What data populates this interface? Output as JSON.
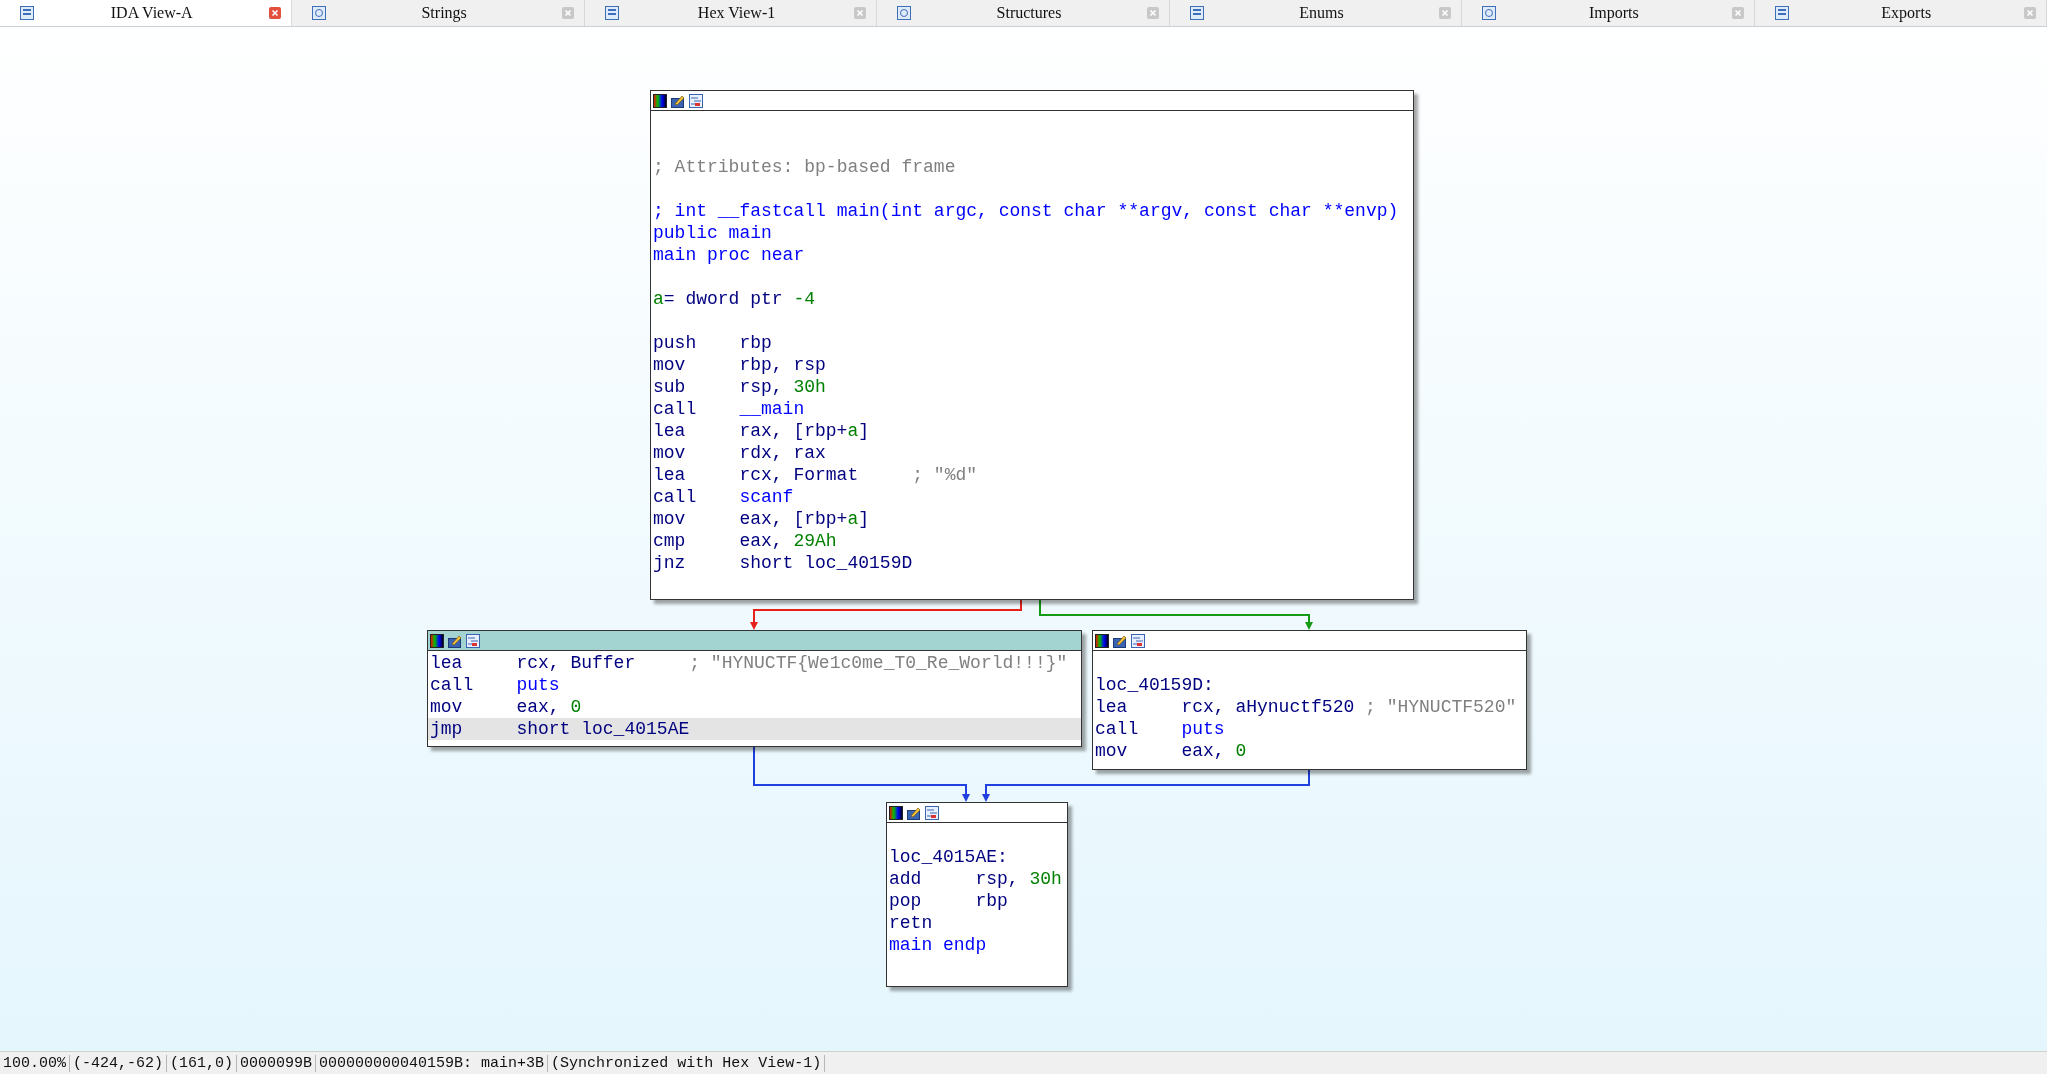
{
  "tabs": [
    {
      "label": "IDA View-A",
      "selected": true
    },
    {
      "label": "Strings",
      "selected": false
    },
    {
      "label": "Hex View-1",
      "selected": false
    },
    {
      "label": "Structures",
      "selected": false
    },
    {
      "label": "Enums",
      "selected": false
    },
    {
      "label": "Imports",
      "selected": false
    },
    {
      "label": "Exports",
      "selected": false
    }
  ],
  "graph": {
    "blocks": [
      {
        "active": false,
        "lines": [
          {
            "kind": "blank"
          },
          {
            "kind": "blank"
          },
          {
            "kind": "code",
            "selected": false,
            "parts": [
              {
                "kind": "comment",
                "text": "; Attributes: bp-based frame"
              }
            ]
          },
          {
            "kind": "blank"
          },
          {
            "kind": "code",
            "selected": false,
            "parts": [
              {
                "kind": "name",
                "text": "; int __fastcall main(int argc, const char **argv, const char **envp)"
              }
            ]
          },
          {
            "kind": "code",
            "selected": false,
            "parts": [
              {
                "kind": "name",
                "text": "public main"
              }
            ]
          },
          {
            "kind": "code",
            "selected": false,
            "parts": [
              {
                "kind": "name",
                "text": "main proc near"
              }
            ]
          },
          {
            "kind": "blank"
          },
          {
            "kind": "code",
            "selected": false,
            "parts": [
              {
                "kind": "number",
                "text": "a"
              },
              {
                "kind": "plain",
                "text": "= dword ptr "
              },
              {
                "kind": "number",
                "text": "-4"
              }
            ]
          },
          {
            "kind": "blank"
          },
          {
            "kind": "code",
            "selected": false,
            "parts": [
              {
                "kind": "mnemonic",
                "text": "push"
              },
              {
                "kind": "plain",
                "text": "rbp"
              }
            ]
          },
          {
            "kind": "code",
            "selected": false,
            "parts": [
              {
                "kind": "mnemonic",
                "text": "mov"
              },
              {
                "kind": "plain",
                "text": "rbp, rsp"
              }
            ]
          },
          {
            "kind": "code",
            "selected": false,
            "parts": [
              {
                "kind": "mnemonic",
                "text": "sub"
              },
              {
                "kind": "plain",
                "text": "rsp, "
              },
              {
                "kind": "number",
                "text": "30h"
              }
            ]
          },
          {
            "kind": "code",
            "selected": false,
            "parts": [
              {
                "kind": "mnemonic",
                "text": "call"
              },
              {
                "kind": "name",
                "text": "__main"
              }
            ]
          },
          {
            "kind": "code",
            "selected": false,
            "parts": [
              {
                "kind": "mnemonic",
                "text": "lea"
              },
              {
                "kind": "plain",
                "text": "rax, [rbp+"
              },
              {
                "kind": "number",
                "text": "a"
              },
              {
                "kind": "plain",
                "text": "]"
              }
            ]
          },
          {
            "kind": "code",
            "selected": false,
            "parts": [
              {
                "kind": "mnemonic",
                "text": "mov"
              },
              {
                "kind": "plain",
                "text": "rdx, rax"
              }
            ]
          },
          {
            "kind": "code",
            "selected": false,
            "parts": [
              {
                "kind": "mnemonic",
                "text": "lea"
              },
              {
                "kind": "plain",
                "text": "rcx, Format     "
              },
              {
                "kind": "comment",
                "text": "; \"%d\""
              }
            ]
          },
          {
            "kind": "code",
            "selected": false,
            "parts": [
              {
                "kind": "mnemonic",
                "text": "call"
              },
              {
                "kind": "name",
                "text": "scanf"
              }
            ]
          },
          {
            "kind": "code",
            "selected": false,
            "parts": [
              {
                "kind": "mnemonic",
                "text": "mov"
              },
              {
                "kind": "plain",
                "text": "eax, [rbp+"
              },
              {
                "kind": "number",
                "text": "a"
              },
              {
                "kind": "plain",
                "text": "]"
              }
            ]
          },
          {
            "kind": "code",
            "selected": false,
            "parts": [
              {
                "kind": "mnemonic",
                "text": "cmp"
              },
              {
                "kind": "plain",
                "text": "eax, "
              },
              {
                "kind": "number",
                "text": "29Ah"
              }
            ]
          },
          {
            "kind": "code",
            "selected": false,
            "parts": [
              {
                "kind": "mnemonic",
                "text": "jnz"
              },
              {
                "kind": "plain",
                "text": "short loc_40159D"
              }
            ]
          }
        ]
      },
      {
        "active": true,
        "lines": [
          {
            "kind": "code",
            "selected": false,
            "parts": [
              {
                "kind": "mnemonic",
                "text": "lea"
              },
              {
                "kind": "plain",
                "text": "rcx, Buffer     "
              },
              {
                "kind": "comment",
                "text": "; \"HYNUCTF{We1c0me_T0_Re_World!!!}\""
              }
            ]
          },
          {
            "kind": "code",
            "selected": false,
            "parts": [
              {
                "kind": "mnemonic",
                "text": "call"
              },
              {
                "kind": "name",
                "text": "puts"
              }
            ]
          },
          {
            "kind": "code",
            "selected": false,
            "parts": [
              {
                "kind": "mnemonic",
                "text": "mov"
              },
              {
                "kind": "plain",
                "text": "eax, "
              },
              {
                "kind": "number",
                "text": "0"
              }
            ]
          },
          {
            "kind": "code",
            "selected": true,
            "parts": [
              {
                "kind": "mnemonic",
                "text": "jmp"
              },
              {
                "kind": "plain",
                "text": "short loc_4015AE"
              }
            ]
          }
        ]
      },
      {
        "active": false,
        "lines": [
          {
            "kind": "blank"
          },
          {
            "kind": "code",
            "selected": false,
            "parts": [
              {
                "kind": "plain",
                "text": "loc_40159D:"
              }
            ]
          },
          {
            "kind": "code",
            "selected": false,
            "parts": [
              {
                "kind": "mnemonic",
                "text": "lea"
              },
              {
                "kind": "plain",
                "text": "rcx, aHynuctf520 "
              },
              {
                "kind": "comment",
                "text": "; \"HYNUCTF520\""
              }
            ]
          },
          {
            "kind": "code",
            "selected": false,
            "parts": [
              {
                "kind": "mnemonic",
                "text": "call"
              },
              {
                "kind": "name",
                "text": "puts"
              }
            ]
          },
          {
            "kind": "code",
            "selected": false,
            "parts": [
              {
                "kind": "mnemonic",
                "text": "mov"
              },
              {
                "kind": "plain",
                "text": "eax, "
              },
              {
                "kind": "number",
                "text": "0"
              }
            ]
          }
        ]
      },
      {
        "active": false,
        "lines": [
          {
            "kind": "blank"
          },
          {
            "kind": "code",
            "selected": false,
            "parts": [
              {
                "kind": "plain",
                "text": "loc_4015AE:"
              }
            ]
          },
          {
            "kind": "code",
            "selected": false,
            "parts": [
              {
                "kind": "mnemonic",
                "text": "add"
              },
              {
                "kind": "plain",
                "text": "rsp, "
              },
              {
                "kind": "number",
                "text": "30h"
              }
            ]
          },
          {
            "kind": "code",
            "selected": false,
            "parts": [
              {
                "kind": "mnemonic",
                "text": "pop"
              },
              {
                "kind": "plain",
                "text": "rbp"
              }
            ]
          },
          {
            "kind": "code",
            "selected": false,
            "parts": [
              {
                "kind": "plain",
                "text": "retn"
              }
            ]
          },
          {
            "kind": "code",
            "selected": false,
            "parts": [
              {
                "kind": "name",
                "text": "main endp"
              }
            ]
          }
        ]
      }
    ],
    "edges": [
      {
        "color": "#e8201c"
      },
      {
        "color": "#149a14"
      },
      {
        "color": "#2040e0"
      },
      {
        "color": "#2040e0"
      }
    ]
  },
  "status_bar": [
    "100.00%",
    "(-424,-62)",
    "(161,0)",
    "0000099B",
    "000000000040159B: main+3B",
    "(Synchronized with Hex View-1)"
  ]
}
